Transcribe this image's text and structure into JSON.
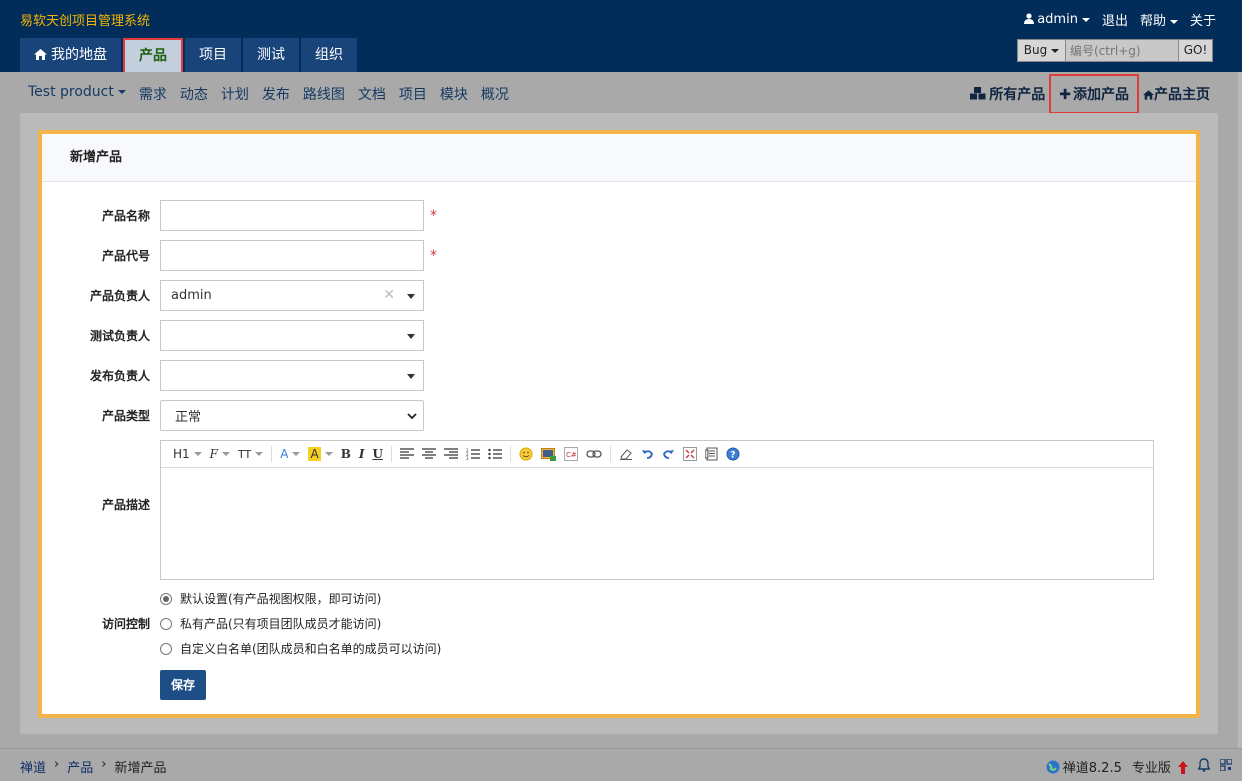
{
  "app": {
    "title": "易软天创项目管理系统"
  },
  "user_menu": {
    "user": "admin",
    "logout": "退出",
    "help": "帮助",
    "about": "关于"
  },
  "main_tabs": [
    {
      "label": "我的地盘"
    },
    {
      "label": "产品"
    },
    {
      "label": "项目"
    },
    {
      "label": "测试"
    },
    {
      "label": "组织"
    }
  ],
  "search": {
    "type": "Bug",
    "placeholder": "编号(ctrl+g)",
    "go": "GO!"
  },
  "subnav": {
    "product": "Test product",
    "items": [
      "需求",
      "动态",
      "计划",
      "发布",
      "路线图",
      "文档",
      "项目",
      "模块",
      "概况"
    ],
    "all_products": "所有产品",
    "add_product": "添加产品",
    "product_home": "产品主页"
  },
  "form": {
    "title": "新增产品",
    "name_label": "产品名称",
    "code_label": "产品代号",
    "po_label": "产品负责人",
    "po_value": "admin",
    "qd_label": "测试负责人",
    "rd_label": "发布负责人",
    "type_label": "产品类型",
    "type_value": "正常",
    "desc_label": "产品描述",
    "acl_label": "访问控制",
    "acl_options": [
      "默认设置(有产品视图权限，即可访问)",
      "私有产品(只有项目团队成员才能访问)",
      "自定义白名单(团队成员和白名单的成员可以访问)"
    ],
    "acl_selected": 0,
    "save": "保存"
  },
  "editor_toolbar": {
    "h1": "H1",
    "font": "F",
    "size": "TT",
    "color": "A",
    "bg": "A",
    "bold": "B",
    "italic": "I",
    "underline": "U"
  },
  "breadcrumb": {
    "root": "禅道",
    "module": "产品",
    "page": "新增产品"
  },
  "footer": {
    "version": "禅道8.2.5",
    "edition": "专业版"
  },
  "colors": {
    "topbar": "#022c5a",
    "accent": "#f4b400",
    "highlight": "#e03c3c",
    "panel_border": "#f3b54b"
  }
}
